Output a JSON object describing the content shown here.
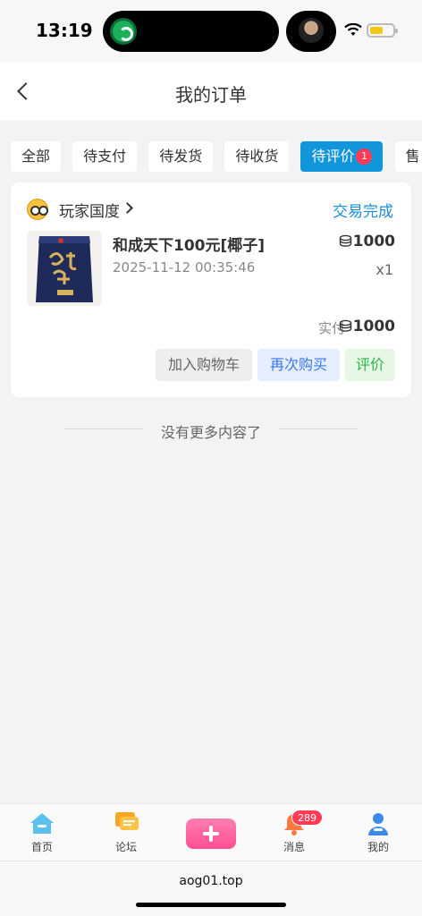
{
  "status_bar": {
    "time": "13:19"
  },
  "header": {
    "title": "我的订单"
  },
  "tabs": [
    {
      "label": "全部"
    },
    {
      "label": "待支付"
    },
    {
      "label": "待发货"
    },
    {
      "label": "待收货"
    },
    {
      "label": "待评价",
      "badge": "1",
      "active": true
    },
    {
      "label": "售"
    }
  ],
  "order": {
    "shop_name": "玩家国度",
    "status": "交易完成",
    "product_name": "和成天下100元[椰子]",
    "time": "2025-11-12 00:35:46",
    "price": "1000",
    "quantity": "x1",
    "paid_label": "实付",
    "paid_value": "1000",
    "buttons": {
      "add_cart": "加入购物车",
      "rebuy": "再次购买",
      "review": "评价"
    }
  },
  "list_footer": "没有更多内容了",
  "bottom_nav": {
    "home": "首页",
    "forum": "论坛",
    "messages": "消息",
    "messages_badge": "289",
    "mine": "我的"
  },
  "url": "aog01.top",
  "colors": {
    "accent": "#1296db",
    "status_link": "#1a8fd9",
    "badge": "#ff3b55",
    "post_button": "#ff4f92"
  }
}
